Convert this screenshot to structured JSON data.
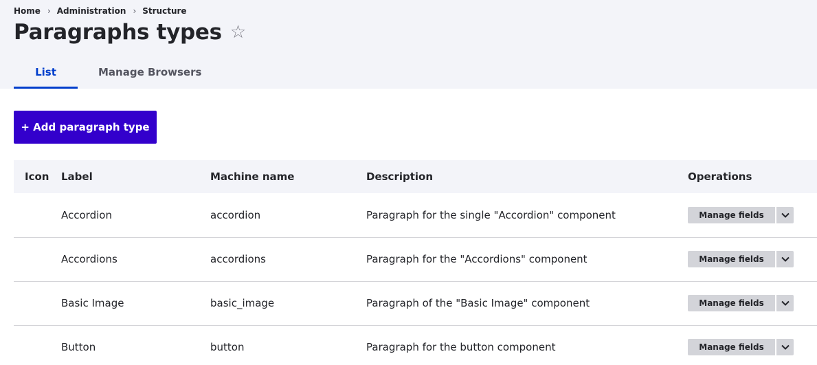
{
  "breadcrumb": [
    "Home",
    "Administration",
    "Structure"
  ],
  "page_title": "Paragraphs types",
  "tabs": [
    {
      "label": "List",
      "active": true
    },
    {
      "label": "Manage Browsers",
      "active": false
    }
  ],
  "add_button_label": "+ Add paragraph type",
  "table": {
    "headers": [
      "Icon",
      "Label",
      "Machine name",
      "Description",
      "Operations"
    ],
    "rows": [
      {
        "icon": "",
        "label": "Accordion",
        "machine_name": "accordion",
        "description": "Paragraph for the single \"Accordion\" component",
        "operation": "Manage fields"
      },
      {
        "icon": "",
        "label": "Accordions",
        "machine_name": "accordions",
        "description": "Paragraph for the \"Accordions\" component",
        "operation": "Manage fields"
      },
      {
        "icon": "",
        "label": "Basic Image",
        "machine_name": "basic_image",
        "description": "Paragraph of the \"Basic Image\" component",
        "operation": "Manage fields"
      },
      {
        "icon": "",
        "label": "Button",
        "machine_name": "button",
        "description": "Paragraph for the button component",
        "operation": "Manage fields"
      }
    ]
  },
  "icons": {
    "favorite": "star-outline-icon",
    "dropdown": "chevron-down-icon"
  },
  "colors": {
    "accent": "#003ecc",
    "button": "#3300cc",
    "header_bg": "#f3f4f9"
  }
}
